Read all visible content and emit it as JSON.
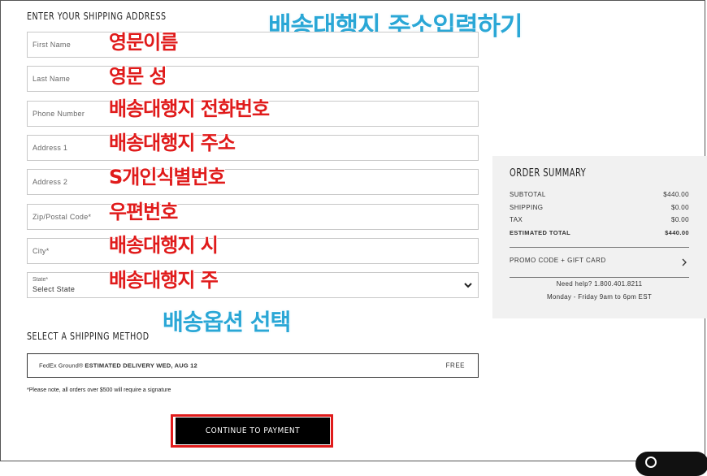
{
  "shipping_address": {
    "title": "ENTER YOUR SHIPPING ADDRESS",
    "fields": [
      {
        "placeholder": "First Name",
        "annotation": "영문이름"
      },
      {
        "placeholder": "Last Name",
        "annotation": "영문 성"
      },
      {
        "placeholder": "Phone Number",
        "annotation": "배송대행지 전화번호"
      },
      {
        "placeholder": "Address 1",
        "annotation": "배송대행지 주소"
      },
      {
        "placeholder": "Address 2",
        "annotation": "S개인식별번호"
      },
      {
        "placeholder": "Zip/Postal Code*",
        "annotation": "우편번호"
      },
      {
        "placeholder": "City*",
        "annotation": "배송대행지 시"
      }
    ],
    "state": {
      "label": "State*",
      "value": "Select State",
      "annotation": "배송대행지 주"
    }
  },
  "annotations": {
    "address_heading": "배송대행지 주소입력하기",
    "shipping_heading": "배송옵션 선택"
  },
  "shipping_method": {
    "title": "SELECT A SHIPPING METHOD",
    "carrier": "FedEx Ground®",
    "delivery": "ESTIMATED DELIVERY WED, AUG 12",
    "price": "FREE",
    "note": "*Please note, all orders over $500 will require a signature"
  },
  "continue_label": "CONTINUE TO PAYMENT",
  "order_summary": {
    "title": "ORDER SUMMARY",
    "rows": [
      {
        "label": "SUBTOTAL",
        "value": "$440.00"
      },
      {
        "label": "SHIPPING",
        "value": "$0.00"
      },
      {
        "label": "TAX",
        "value": "$0.00"
      }
    ],
    "total": {
      "label": "ESTIMATED TOTAL",
      "value": "$440.00"
    },
    "promo": "PROMO CODE + GIFT CARD",
    "help_line1": "Need help? 1.800.401.8211",
    "help_line2": "Monday - Friday 9am to 6pm EST"
  },
  "colors": {
    "annotation_red": "#e01b1b",
    "annotation_blue": "#2aa7d6",
    "button_bg": "#000000",
    "summary_bg": "#f1f1f1"
  },
  "icons": {
    "select_chevron": "chevron-down-icon",
    "promo_arrow": "chevron-right-icon",
    "chat": "chat-icon"
  }
}
